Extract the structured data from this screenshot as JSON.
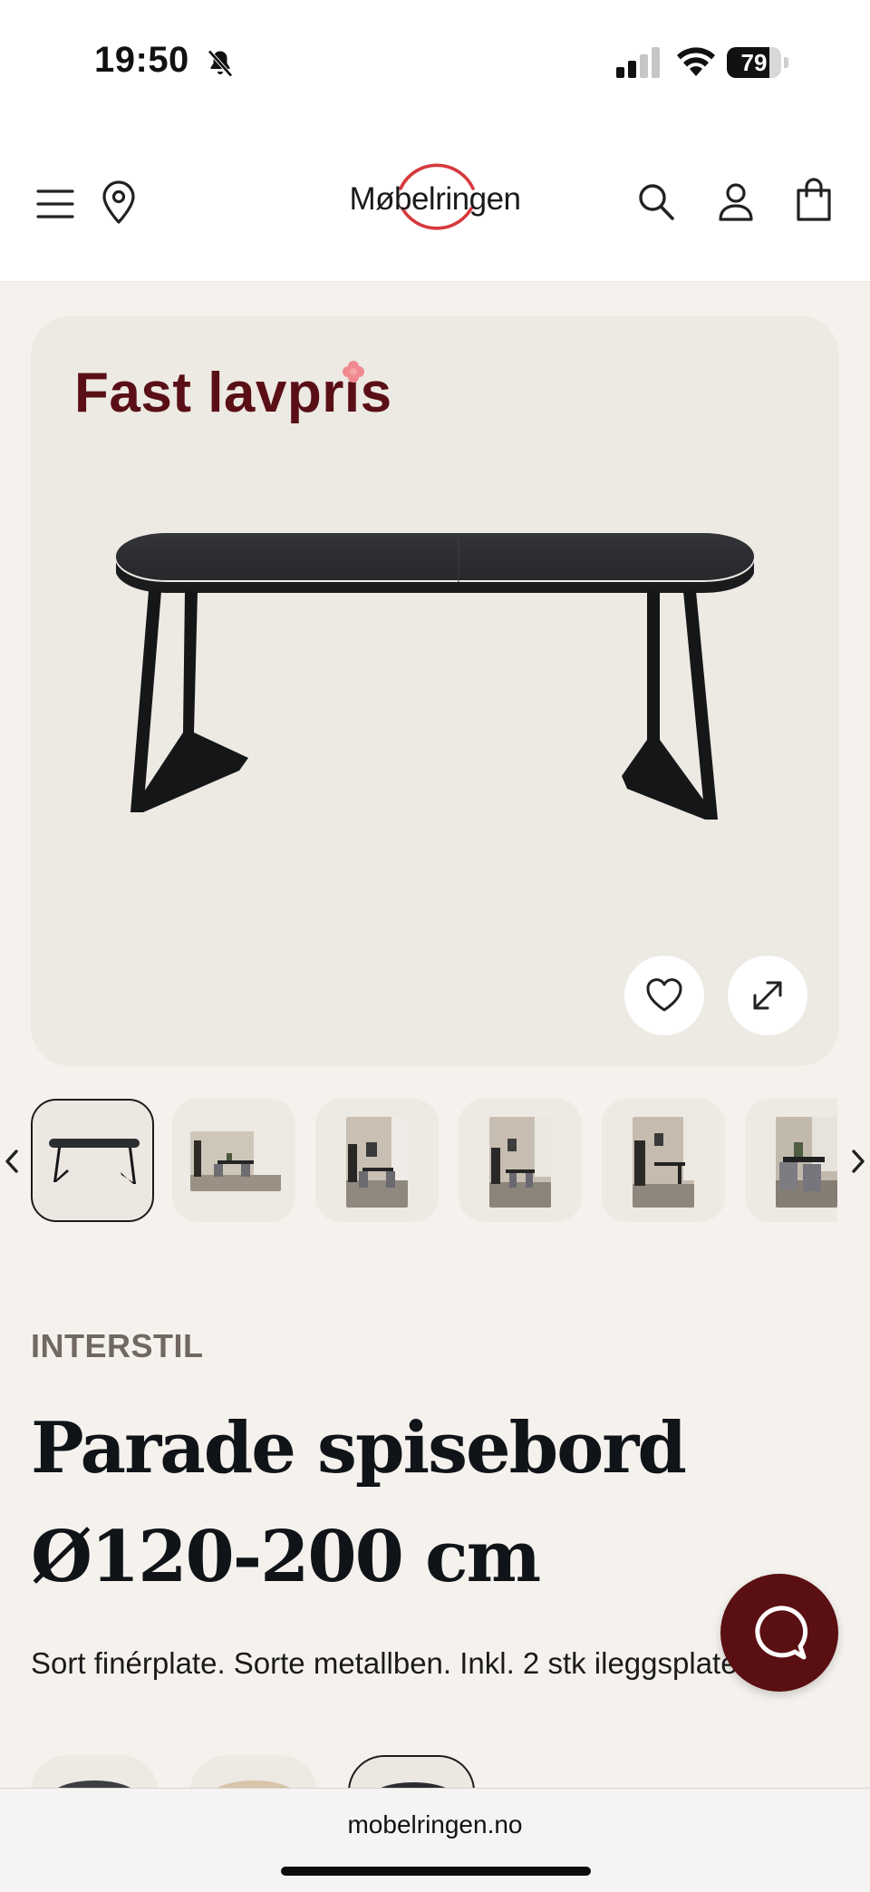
{
  "status_bar": {
    "time": "19:50",
    "battery": "79",
    "battery_level": 0.79
  },
  "header": {
    "logo_text": "Møbelringen",
    "brand_color": "#d6393d",
    "icons": [
      "menu-icon",
      "location-icon",
      "search-icon",
      "account-icon",
      "bag-icon"
    ]
  },
  "hero": {
    "promo_label": "Fast lavpris",
    "promo_color": "#5a0f16",
    "actions": [
      "heart-icon",
      "expand-icon"
    ]
  },
  "gallery": {
    "thumbnail_count": 6,
    "active_index": 0
  },
  "product": {
    "brand": "INTERSTIL",
    "title": "Parade spisebord Ø120-200 cm",
    "description": "Sort finérplate. Sorte metallben. Inkl. 2 stk ileggsplater."
  },
  "chat": {
    "color": "#5a0f12"
  },
  "browser": {
    "url": "mobelringen.no"
  }
}
